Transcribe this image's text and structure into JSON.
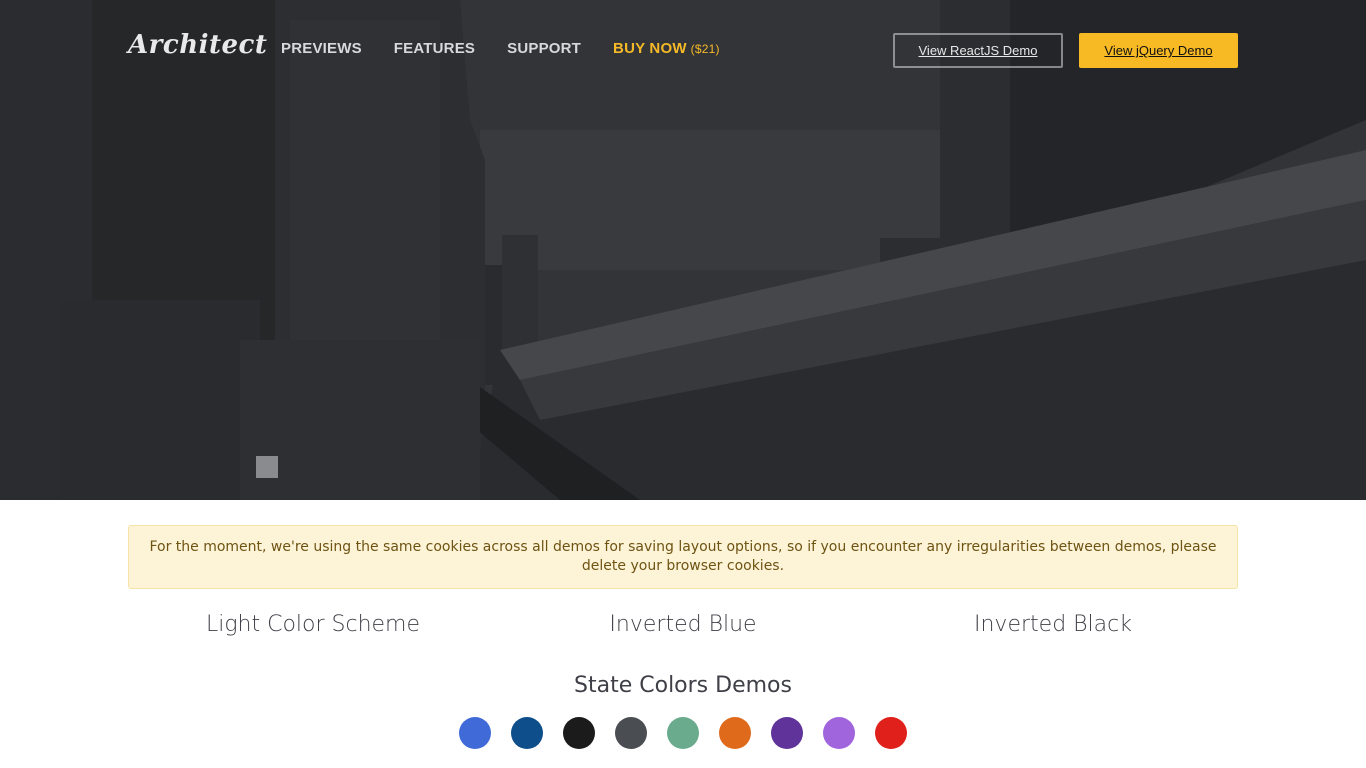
{
  "brand": {
    "logo_text": "Architect"
  },
  "nav": {
    "previews": "PREVIEWS",
    "features": "FEATURES",
    "support": "SUPPORT",
    "buy_now": "BUY NOW",
    "buy_price": "($21)"
  },
  "header_buttons": {
    "react_demo": "View ReactJS Demo",
    "jquery_demo": "View jQuery Demo"
  },
  "alert": {
    "text": "For the moment, we're using the same cookies across all demos for saving layout options, so if you encounter any irregularities between demos, please delete your browser cookies."
  },
  "schemes": [
    {
      "label": "Light Color Scheme"
    },
    {
      "label": "Inverted Blue"
    },
    {
      "label": "Inverted Black"
    }
  ],
  "state_colors": {
    "title": "State Colors Demos",
    "swatches": [
      "#3f6ad8",
      "#0e4e8a",
      "#1b1b1b",
      "#4a4d52",
      "#6aab8e",
      "#e06a1c",
      "#5f339a",
      "#a064dc",
      "#e0211b"
    ]
  },
  "colors": {
    "accent": "#f7b924",
    "alert_bg": "#fdf4d8",
    "alert_text": "#6e5313"
  },
  "hero": {
    "image_icon": "city-train-background-image"
  }
}
